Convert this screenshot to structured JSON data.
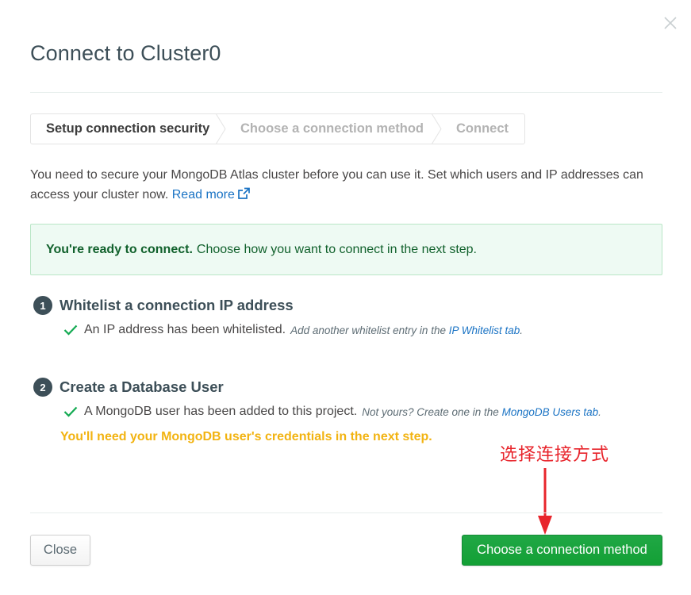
{
  "modal": {
    "title": "Connect to Cluster0"
  },
  "steps": [
    {
      "label": "Setup connection security",
      "active": true
    },
    {
      "label": "Choose a connection method",
      "active": false
    },
    {
      "label": "Connect",
      "active": false
    }
  ],
  "intro": {
    "text": "You need to secure your MongoDB Atlas cluster before you can use it. Set which users and IP addresses can access your cluster now.",
    "link_label": "Read more"
  },
  "alert": {
    "strong": "You're ready to connect.",
    "text": "Choose how you want to connect in the next step."
  },
  "section1": {
    "number": "1",
    "title": "Whitelist a connection IP address",
    "status": "An IP address has been whitelisted.",
    "hint": "Add another whitelist entry in the",
    "link_label": "IP Whitelist tab",
    "hint_end": "."
  },
  "section2": {
    "number": "2",
    "title": "Create a Database User",
    "status": "A MongoDB user has been added to this project.",
    "hint": "Not yours? Create one in the",
    "link_label": "MongoDB Users tab",
    "hint_end": "."
  },
  "warning": "You'll need your MongoDB user's credentials in the next step.",
  "annotation": "选择连接方式",
  "footer": {
    "close_label": "Close",
    "primary_label": "Choose a connection method"
  },
  "colors": {
    "primary": "#13a035",
    "link": "#1a73c4",
    "warning": "#f2b311",
    "annotation": "#e8252c",
    "success": "#13aa52"
  },
  "icons": {
    "close": "close-icon",
    "external": "external-link-icon",
    "check": "check-icon",
    "arrow": "arrow-down-icon"
  }
}
